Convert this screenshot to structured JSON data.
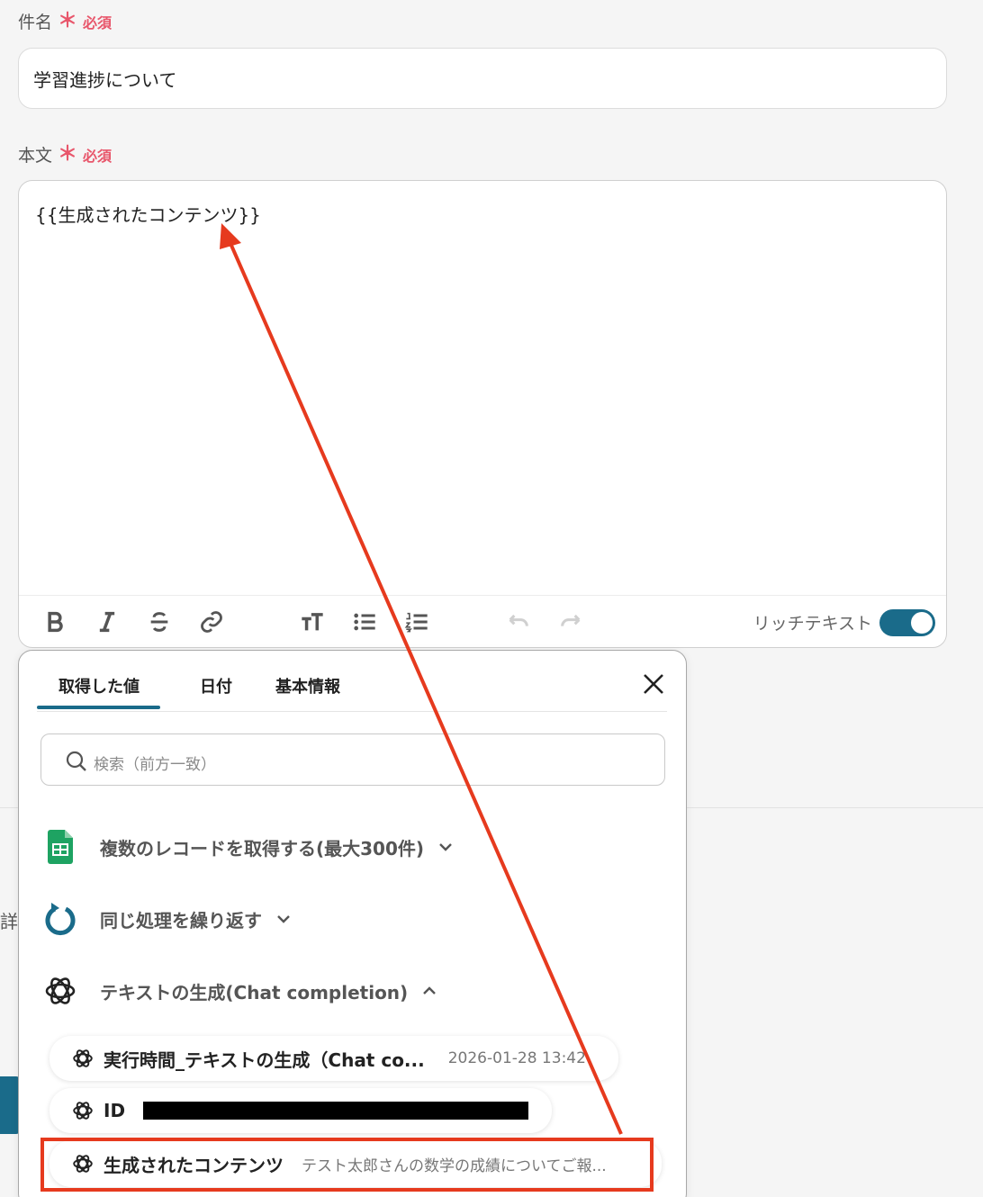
{
  "form": {
    "subject_label": "件名",
    "body_label": "本文",
    "required_mark": "＊",
    "required_text": "必須",
    "subject_value": "学習進捗について",
    "body_value": "{{生成されたコンテンツ}}"
  },
  "toolbar": {
    "rich_text_label": "リッチテキスト",
    "rich_text_enabled": true,
    "tools": [
      "bold-icon",
      "italic-icon",
      "strikethrough-icon",
      "link-icon",
      "text-size-icon",
      "bullet-list-icon",
      "numbered-list-icon",
      "undo-icon",
      "redo-icon"
    ]
  },
  "background": {
    "cut_text": "詳"
  },
  "picker": {
    "tabs": [
      "取得した値",
      "日付",
      "基本情報"
    ],
    "active_tab": "取得した値",
    "search_placeholder": "検索（前方一致）",
    "groups": [
      {
        "label": "複数のレコードを取得する(最大300件)",
        "icon": "google-sheets-icon",
        "expanded": false
      },
      {
        "label": "同じ処理を繰り返す",
        "icon": "loop-icon",
        "expanded": false
      },
      {
        "label": "テキストの生成(Chat completion)",
        "icon": "openai-icon",
        "expanded": true
      }
    ],
    "items": [
      {
        "label": "実行時間_テキストの生成（Chat co...",
        "value": "2026-01-28 13:42"
      },
      {
        "label": "ID",
        "value": ""
      },
      {
        "label": "生成されたコンテンツ",
        "value": "テスト太郎さんの数学の成績についてご報..."
      }
    ]
  },
  "colors": {
    "accent": "#1a6b8a",
    "required": "#e8566b",
    "annotation": "#e63a1e",
    "sheets_green": "#1ea362"
  }
}
